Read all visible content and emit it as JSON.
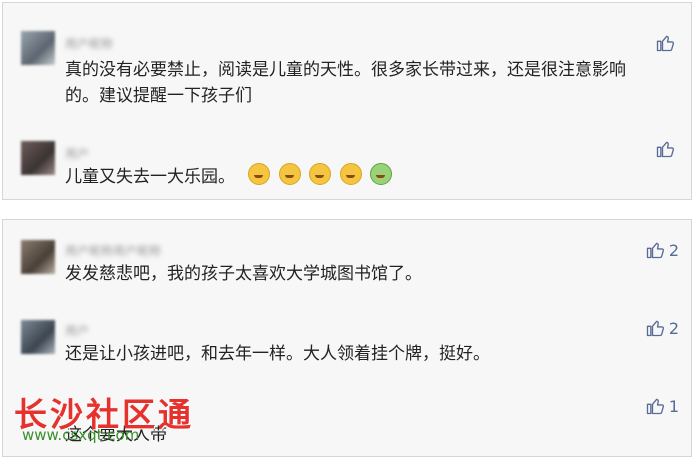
{
  "panel1": {
    "comments": [
      {
        "author": "用户昵称",
        "text": "真的没有必要禁止，阅读是儿童的天性。很多家长带过来，还是很注意影响的。建议提醒一下孩子们",
        "likes": ""
      },
      {
        "author": "用户",
        "text": "儿童又失去一大乐园。",
        "likes": ""
      }
    ]
  },
  "panel2": {
    "comments": [
      {
        "author": "用户昵称用户昵称",
        "text": "发发慈悲吧，我的孩子太喜欢大学城图书馆了。",
        "likes": "2"
      },
      {
        "author": "用户",
        "text": "还是让小孩进吧，和去年一样。大人领着挂个牌，挺好。",
        "likes": "2"
      },
      {
        "author": "用户",
        "text": "这个要大人带",
        "likes": "1"
      }
    ]
  },
  "watermark": {
    "title": "长沙社区通",
    "url": "www.csxqt.com"
  },
  "colors": {
    "like_blue": "#576b95",
    "watermark_red": "#e6322d",
    "watermark_green": "#3a8f2e"
  },
  "icons": {
    "like": "thumbs-up-icon",
    "emoji": "emoji-face-icon"
  }
}
